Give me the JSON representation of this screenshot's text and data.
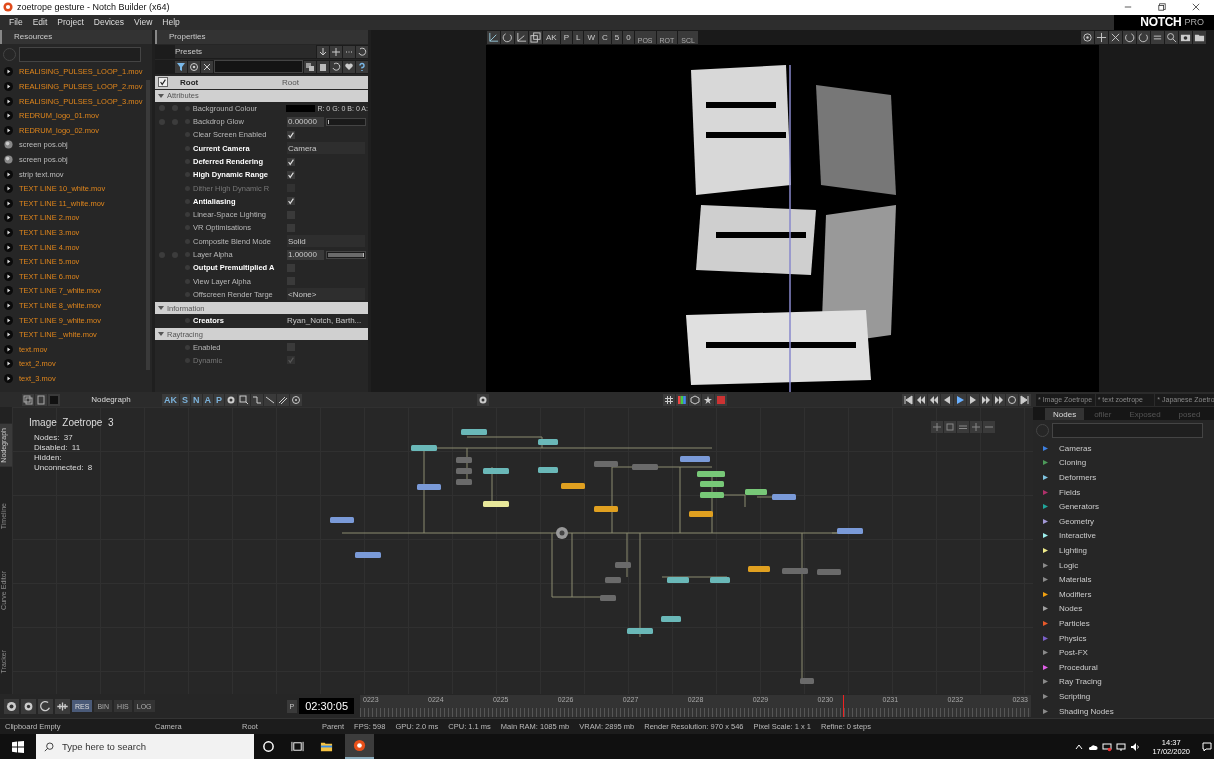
{
  "window": {
    "title": "zoetrope gesture - Notch Builder (x64)"
  },
  "menu": [
    "File",
    "Edit",
    "Project",
    "Devices",
    "View",
    "Help"
  ],
  "logo": {
    "brand": "NOTCH",
    "edition": "PRO"
  },
  "resources": {
    "title": "Resources",
    "files": [
      {
        "name": "REALISING_PULSES_LOOP_1.mov",
        "kind": "video",
        "in_use": true
      },
      {
        "name": "REALISING_PULSES_LOOP_2.mov",
        "kind": "video",
        "in_use": true
      },
      {
        "name": "REALISING_PULSES_LOOP_3.mov",
        "kind": "video",
        "in_use": true
      },
      {
        "name": "REDRUM_logo_01.mov",
        "kind": "video",
        "in_use": true
      },
      {
        "name": "REDRUM_logo_02.mov",
        "kind": "video",
        "in_use": true
      },
      {
        "name": "screen pos.obj",
        "kind": "object",
        "in_use": false
      },
      {
        "name": "screen pos.obj",
        "kind": "object",
        "in_use": false
      },
      {
        "name": "strip text.mov",
        "kind": "video",
        "in_use": false
      },
      {
        "name": "TEXT LINE 10_white.mov",
        "kind": "video",
        "in_use": true
      },
      {
        "name": "TEXT LINE 11_white.mov",
        "kind": "video",
        "in_use": true
      },
      {
        "name": "TEXT LINE 2.mov",
        "kind": "video",
        "in_use": true
      },
      {
        "name": "TEXT LINE 3.mov",
        "kind": "video",
        "in_use": true
      },
      {
        "name": "TEXT LINE 4.mov",
        "kind": "video",
        "in_use": true
      },
      {
        "name": "TEXT LINE 5.mov",
        "kind": "video",
        "in_use": true
      },
      {
        "name": "TEXT LINE 6.mov",
        "kind": "video",
        "in_use": true
      },
      {
        "name": "TEXT LINE 7_white.mov",
        "kind": "video",
        "in_use": true
      },
      {
        "name": "TEXT LINE 8_white.mov",
        "kind": "video",
        "in_use": true
      },
      {
        "name": "TEXT LINE 9_white.mov",
        "kind": "video",
        "in_use": true
      },
      {
        "name": "TEXT LINE _white.mov",
        "kind": "video",
        "in_use": true
      },
      {
        "name": "text.mov",
        "kind": "video",
        "in_use": true
      },
      {
        "name": "text_2.mov",
        "kind": "video",
        "in_use": true
      },
      {
        "name": "text_3.mov",
        "kind": "video",
        "in_use": true
      }
    ]
  },
  "properties": {
    "title": "Properties",
    "presets": "Presets",
    "root": {
      "checked": true,
      "name": "Root",
      "type": "Root"
    },
    "sections": [
      {
        "title": "Attributes",
        "expanded": true,
        "rows": [
          {
            "label": "Background Colour",
            "kind": "color",
            "color": "#000000",
            "value": "R: 0 G: 0 B: 0 A:",
            "modified": false,
            "disabled": false,
            "keyable": true
          },
          {
            "label": "Backdrop Glow",
            "kind": "number",
            "value": "0.00000",
            "level": 0,
            "modified": false,
            "disabled": false,
            "keyable": true
          },
          {
            "label": "Clear Screen Enabled",
            "kind": "checkbox",
            "checked": true,
            "modified": false,
            "disabled": false,
            "keyable": false
          },
          {
            "label": "Current Camera",
            "kind": "dropdown",
            "value": "Camera",
            "modified": true,
            "disabled": false,
            "keyable": false
          },
          {
            "label": "Deferred Rendering",
            "kind": "checkbox",
            "checked": true,
            "modified": true,
            "disabled": false,
            "keyable": false
          },
          {
            "label": "High Dynamic Range",
            "kind": "checkbox",
            "checked": true,
            "modified": true,
            "disabled": false,
            "keyable": false
          },
          {
            "label": "Dither High Dynamic R",
            "kind": "checkbox",
            "checked": false,
            "modified": false,
            "disabled": true,
            "keyable": false
          },
          {
            "label": "Antialiasing",
            "kind": "checkbox",
            "checked": true,
            "modified": true,
            "disabled": false,
            "keyable": false
          },
          {
            "label": "Linear-Space Lighting",
            "kind": "checkbox",
            "checked": false,
            "modified": false,
            "disabled": false,
            "keyable": false
          },
          {
            "label": "VR Optimisations",
            "kind": "checkbox",
            "checked": false,
            "modified": false,
            "disabled": false,
            "keyable": false
          },
          {
            "label": "Composite Blend Mode",
            "kind": "dropdown",
            "value": "Solid",
            "modified": false,
            "disabled": false,
            "keyable": false
          },
          {
            "label": "Layer Alpha",
            "kind": "number",
            "value": "1.00000",
            "level": 1,
            "modified": false,
            "disabled": false,
            "keyable": true
          },
          {
            "label": "Output Premultiplied A",
            "kind": "checkbox",
            "checked": false,
            "modified": true,
            "disabled": false,
            "keyable": false
          },
          {
            "label": "View Layer Alpha",
            "kind": "checkbox",
            "checked": false,
            "modified": false,
            "disabled": false,
            "keyable": false
          },
          {
            "label": "Offscreen Render Targe",
            "kind": "dropdown",
            "value": "<None>",
            "modified": false,
            "disabled": false,
            "keyable": false
          }
        ]
      },
      {
        "title": "Information",
        "expanded": true,
        "rows": [
          {
            "label": "Creators",
            "kind": "text",
            "value": "Ryan_Notch, Barth...",
            "modified": true,
            "disabled": false,
            "keyable": false
          }
        ]
      },
      {
        "title": "Raytracing",
        "expanded": true,
        "rows": [
          {
            "label": "Enabled",
            "kind": "checkbox",
            "checked": false,
            "modified": false,
            "disabled": false,
            "keyable": false
          },
          {
            "label": "Dynamic",
            "kind": "checkbox",
            "checked": true,
            "modified": false,
            "disabled": true,
            "keyable": false
          }
        ]
      }
    ]
  },
  "viewport_toolbar": {
    "labels": [
      "AK",
      "P",
      "L",
      "W",
      "C",
      "5",
      "0"
    ],
    "groups": [
      "POS",
      "ROT",
      "SCL"
    ]
  },
  "nodegraph": {
    "title": "Nodegraph",
    "tools": [
      "AK",
      "S",
      "N",
      "A",
      "P"
    ],
    "side_tabs": [
      {
        "label": "Nodegraph",
        "selected": true
      },
      {
        "label": "Timeline",
        "selected": false
      },
      {
        "label": "Curve Editor",
        "selected": false
      },
      {
        "label": "Tracker",
        "selected": false
      }
    ],
    "graph_title": "Image  Zoetrope  3",
    "stats": [
      "Nodes:  37",
      "Disabled:  11",
      "Hidden:",
      "Unconnected:  8"
    ]
  },
  "doc_tabs": [
    "* Image Zoetrope",
    "* text zoetrope",
    "* Japanese Zoetro"
  ],
  "node_panel": {
    "tabs": [
      {
        "label": "Nodes",
        "selected": true
      },
      {
        "label": "ofiler",
        "selected": false
      },
      {
        "label": "Exposed",
        "selected": false
      },
      {
        "label": "posed",
        "selected": false
      }
    ],
    "categories": [
      {
        "name": "Cameras",
        "color": "#3d7fe0"
      },
      {
        "name": "Cloning",
        "color": "#4c9a5a"
      },
      {
        "name": "Deformers",
        "color": "#7fc4e0"
      },
      {
        "name": "Fields",
        "color": "#b0306a"
      },
      {
        "name": "Generators",
        "color": "#1fa59a"
      },
      {
        "name": "Geometry",
        "color": "#a49ad8"
      },
      {
        "name": "Interactive",
        "color": "#9ef0ee"
      },
      {
        "name": "Lighting",
        "color": "#eeea8a"
      },
      {
        "name": "Logic",
        "color": "#8a8a8a"
      },
      {
        "name": "Materials",
        "color": "#8a8a8a"
      },
      {
        "name": "Modifiers",
        "color": "#f0a010"
      },
      {
        "name": "Nodes",
        "color": "#a0a0a0"
      },
      {
        "name": "Particles",
        "color": "#e85a2a"
      },
      {
        "name": "Physics",
        "color": "#7a60c8"
      },
      {
        "name": "Post-FX",
        "color": "#8a8a8a"
      },
      {
        "name": "Procedural",
        "color": "#e060e8"
      },
      {
        "name": "Ray Tracing",
        "color": "#8a8a8a"
      },
      {
        "name": "Scripting",
        "color": "#8a8a8a"
      },
      {
        "name": "Shading Nodes",
        "color": "#8a8a8a"
      }
    ]
  },
  "timeline": {
    "logs": [
      {
        "label": "RES",
        "selected": true
      },
      {
        "label": "BIN",
        "selected": false
      },
      {
        "label": "HIS",
        "selected": false
      },
      {
        "label": "LOG",
        "selected": false
      }
    ],
    "p_button": "P",
    "time": "02:30:05",
    "ticks": [
      "0223",
      "0224",
      "0225",
      "0226",
      "0227",
      "0228",
      "0229",
      "0230",
      "0231",
      "0232",
      "0233"
    ],
    "level": 0.72
  },
  "status_bar": [
    "Clipboard Empty",
    "Camera",
    "Root",
    "Parent",
    "FPS: 598",
    "GPU: 2.0 ms",
    "CPU: 1.1 ms",
    "Main RAM: 1085 mb",
    "VRAM: 2895 mb",
    "Render Resolution: 970 x 546",
    "Pixel Scale: 1 x 1",
    "Refine: 0 steps"
  ],
  "taskbar": {
    "search_placeholder": "Type here to search",
    "time": "14:37",
    "date": "17/02/2020"
  }
}
